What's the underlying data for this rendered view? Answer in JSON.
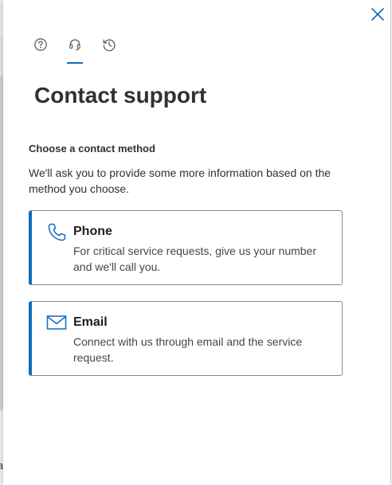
{
  "background": {
    "edge_char": "a"
  },
  "panel": {
    "close_icon": "close-icon",
    "tabs": [
      {
        "icon": "help-icon",
        "active": false
      },
      {
        "icon": "headset-icon",
        "active": true
      },
      {
        "icon": "history-icon",
        "active": false
      }
    ],
    "title": "Contact support",
    "section_heading": "Choose a contact method",
    "section_description": "We'll ask you to provide some more information based on the method you choose.",
    "methods": [
      {
        "icon": "phone-icon",
        "title": "Phone",
        "description": "For critical service requests, give us your number and we'll call you."
      },
      {
        "icon": "mail-icon",
        "title": "Email",
        "description": "Connect with us through email and the service request."
      }
    ]
  },
  "colors": {
    "accent": "#0f6cbd",
    "text": "#323130",
    "card_border": "#8a8886"
  }
}
